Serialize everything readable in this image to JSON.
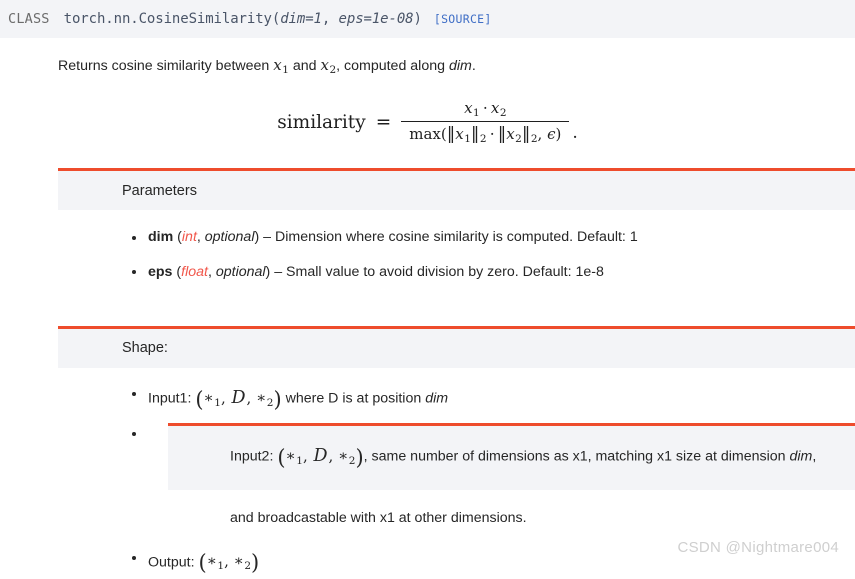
{
  "signature": {
    "kind_label": "CLASS",
    "module_path": "torch.nn.CosineSimilarity",
    "open_paren": "(",
    "param_dim": "dim=1",
    "comma": ", ",
    "param_eps": "eps=1e-08",
    "close_paren": ")",
    "source_link": "[SOURCE]"
  },
  "description": {
    "before_x1": "Returns cosine similarity between ",
    "x1": "x",
    "x1_sub": "1",
    "between": " and ",
    "x2": "x",
    "x2_sub": "2",
    "after_x2": ", computed along ",
    "dim_emph": "dim",
    "period": "."
  },
  "formula": {
    "lhs": "similarity",
    "equals": "=",
    "numerator": {
      "x1": "x",
      "x1_sub": "1",
      "dot": "⋅",
      "x2": "x",
      "x2_sub": "2"
    },
    "denominator": {
      "max": "max",
      "open": "(",
      "norm_open_1": "‖",
      "x1": "x",
      "x1_sub": "1",
      "norm_close_1": "‖",
      "norm_sub_1": "2",
      "dot": "⋅",
      "norm_open_2": "‖",
      "x2": "x",
      "x2_sub": "2",
      "norm_close_2": "‖",
      "norm_sub_2": "2",
      "comma": ", ",
      "epsilon": "ϵ",
      "close": ")"
    },
    "trailing_period": "."
  },
  "parameters_section": {
    "title": "Parameters",
    "items": [
      {
        "name": "dim",
        "open": " (",
        "type": "int",
        "type_sep": ", ",
        "optional": "optional",
        "close": ")",
        "description": " – Dimension where cosine similarity is computed. Default: 1"
      },
      {
        "name": "eps",
        "open": " (",
        "type": "float",
        "type_sep": ", ",
        "optional": "optional",
        "close": ")",
        "description": " – Small value to avoid division by zero. Default: 1e-8"
      }
    ]
  },
  "shape_section": {
    "title": "Shape:",
    "input1": {
      "label": "Input1: ",
      "math_open": "(",
      "star1": "∗",
      "star1_sub": "1",
      "sep1": ", ",
      "D": "D",
      "sep2": ", ",
      "star2": "∗",
      "star2_sub": "2",
      "math_close": ")",
      "tail_before_dim": " where D is at position ",
      "dim_emph": "dim"
    },
    "input2": {
      "label": "Input2: ",
      "math_open": "(",
      "star1": "∗",
      "star1_sub": "1",
      "sep1": ", ",
      "D": "D",
      "sep2": ", ",
      "star2": "∗",
      "star2_sub": "2",
      "math_close": ")",
      "tail": ", same number of dimensions as x1, matching x1 size at dimension ",
      "dim_emph": "dim",
      "tail_end": ",",
      "continuation": "and broadcastable with x1 at other dimensions."
    },
    "output": {
      "label": "Output: ",
      "math_open": "(",
      "star1": "∗",
      "star1_sub": "1",
      "sep1": ", ",
      "star2": "∗",
      "star2_sub": "2",
      "math_close": ")"
    }
  },
  "watermark": "CSDN @Nightmare004",
  "colors": {
    "accent": "#ee4c2c",
    "panel_bg": "#f3f4f7",
    "link": "#3f6ec6",
    "type_red": "#f1574b",
    "text": "#262626"
  }
}
